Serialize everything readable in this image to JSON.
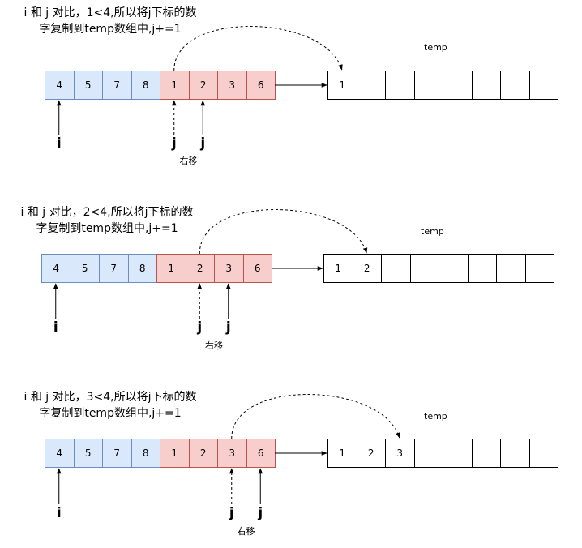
{
  "panels": [
    {
      "caption_line1": "i 和 j 对比，1<4,所以将j下标的数",
      "caption_line2": "字复制到temp数组中,j+=1",
      "array": [
        "4",
        "5",
        "7",
        "8",
        "1",
        "2",
        "3",
        "6"
      ],
      "temp_label": "temp",
      "temp": [
        "1",
        "",
        "",
        "",
        "",
        "",
        "",
        ""
      ],
      "pointer_i": "i",
      "pointer_j_old": "j",
      "pointer_j_new": "j",
      "move_note": "右移"
    },
    {
      "caption_line1": "i 和 j 对比，2<4,所以将j下标的数",
      "caption_line2": "字复制到temp数组中,j+=1",
      "array": [
        "4",
        "5",
        "7",
        "8",
        "1",
        "2",
        "3",
        "6"
      ],
      "temp_label": "temp",
      "temp": [
        "1",
        "2",
        "",
        "",
        "",
        "",
        "",
        ""
      ],
      "pointer_i": "i",
      "pointer_j_old": "j",
      "pointer_j_new": "j",
      "move_note": "右移"
    },
    {
      "caption_line1": "i 和 j 对比，3<4,所以将j下标的数",
      "caption_line2": "字复制到temp数组中,j+=1",
      "array": [
        "4",
        "5",
        "7",
        "8",
        "1",
        "2",
        "3",
        "6"
      ],
      "temp_label": "temp",
      "temp": [
        "1",
        "2",
        "3",
        "",
        "",
        "",
        "",
        ""
      ],
      "pointer_i": "i",
      "pointer_j_old": "j",
      "pointer_j_new": "j",
      "move_note": "右移"
    }
  ],
  "colors": {
    "left_half_fill": "#dae8fc",
    "left_half_stroke": "#6c8ebf",
    "right_half_fill": "#f8cecc",
    "right_half_stroke": "#b85450",
    "temp_fill": "#ffffff"
  }
}
